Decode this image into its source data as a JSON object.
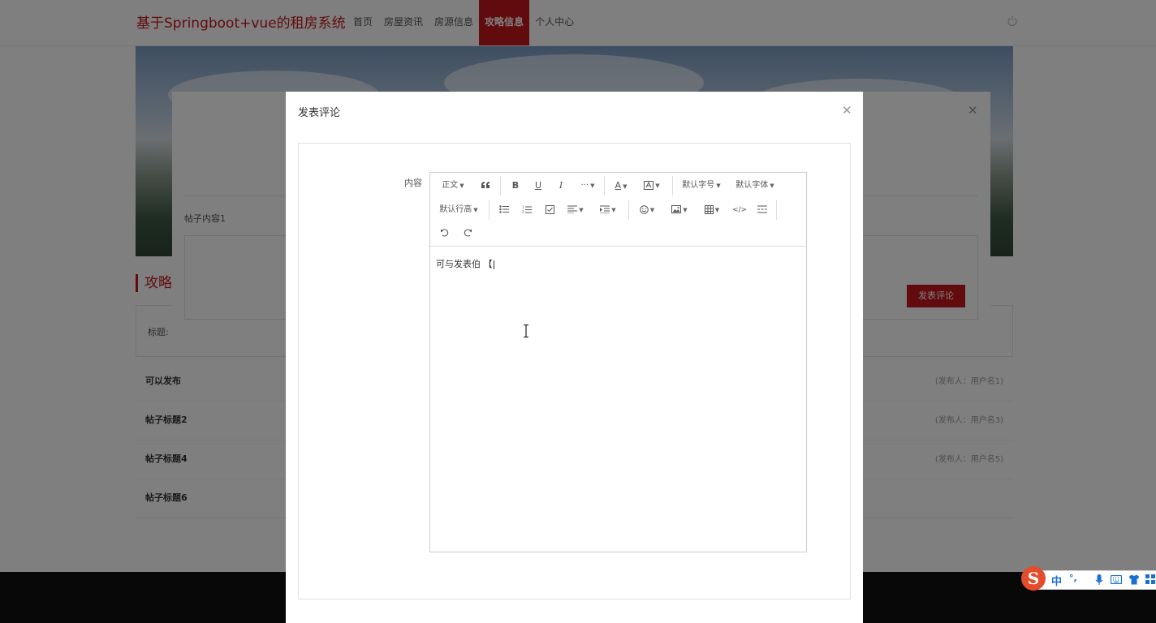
{
  "header": {
    "brand": "基于Springboot+vue的租房系统",
    "nav": [
      {
        "label": "首页",
        "active": false
      },
      {
        "label": "房屋资讯",
        "active": false
      },
      {
        "label": "房源信息",
        "active": false
      },
      {
        "label": "攻略信息",
        "active": true
      },
      {
        "label": "个人中心",
        "active": false
      }
    ],
    "power_icon": "power-icon"
  },
  "main": {
    "section_title": "攻略",
    "search_label": "标题:",
    "posts": [
      {
        "title": "可以发布",
        "meta": "(发布人：用户名1)"
      },
      {
        "title": "帖子标题2",
        "meta": "(发布人：用户名3)"
      },
      {
        "title": "帖子标题4",
        "meta": "(发布人：用户名5)"
      },
      {
        "title": "帖子标题6",
        "meta": ""
      }
    ]
  },
  "back_dialog": {
    "content_label": "帖子内容1",
    "submit_label": "发表评论",
    "close_icon": "close-icon"
  },
  "comment_dialog": {
    "title": "发表评论",
    "close_icon": "close-icon",
    "field_label": "内容",
    "editor": {
      "toolbar": {
        "paragraph": "正文",
        "font_size": "默认字号",
        "font_family": "默认字体",
        "line_height": "默认行高"
      },
      "content": "可与发表伯 【"
    }
  },
  "ime": {
    "logo": "S",
    "mode": "中",
    "punct": "°,"
  },
  "colors": {
    "accent": "#c4161c",
    "mask": "rgba(0,0,0,0.5)",
    "footer": "#111111"
  }
}
